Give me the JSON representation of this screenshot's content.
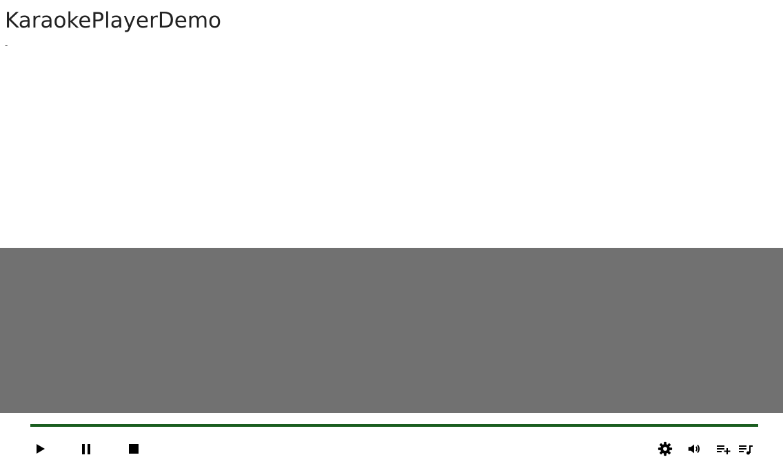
{
  "app": {
    "title": "KaraokePlayerDemo",
    "subtitle": "-"
  },
  "player": {
    "stage_color": "#717171",
    "progress": {
      "fraction": 1.0,
      "color": "#1b5e20"
    },
    "controls": {
      "left": [
        "play-icon",
        "pause-icon",
        "stop-icon"
      ],
      "right": [
        "gear-icon",
        "volume-icon",
        "playlist-add-icon",
        "playlist-music-icon"
      ]
    }
  }
}
